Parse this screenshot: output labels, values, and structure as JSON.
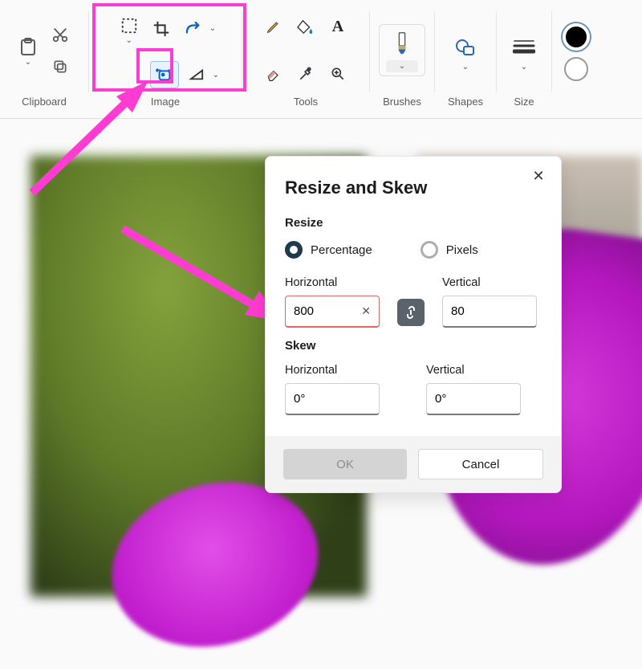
{
  "ribbon": {
    "groups": {
      "clipboard": {
        "label": "Clipboard"
      },
      "image": {
        "label": "Image"
      },
      "tools": {
        "label": "Tools"
      },
      "brushes": {
        "label": "Brushes"
      },
      "shapes": {
        "label": "Shapes"
      },
      "size": {
        "label": "Size"
      }
    }
  },
  "dialog": {
    "title": "Resize and Skew",
    "close_icon": "✕",
    "resize": {
      "heading": "Resize",
      "units": {
        "percentage": "Percentage",
        "pixels": "Pixels",
        "selected": "percentage"
      },
      "horizontal": {
        "label": "Horizontal",
        "value": "800",
        "invalid": true
      },
      "vertical": {
        "label": "Vertical",
        "value": "80"
      },
      "link_aspect": true
    },
    "skew": {
      "heading": "Skew",
      "horizontal": {
        "label": "Horizontal",
        "value": "0°"
      },
      "vertical": {
        "label": "Vertical",
        "value": "0°"
      }
    },
    "buttons": {
      "ok": "OK",
      "cancel": "Cancel"
    }
  },
  "colors": {
    "primary": "#000000",
    "secondary": "#ffffff"
  },
  "annotation": {
    "arrow_color": "#ff3cd1"
  }
}
